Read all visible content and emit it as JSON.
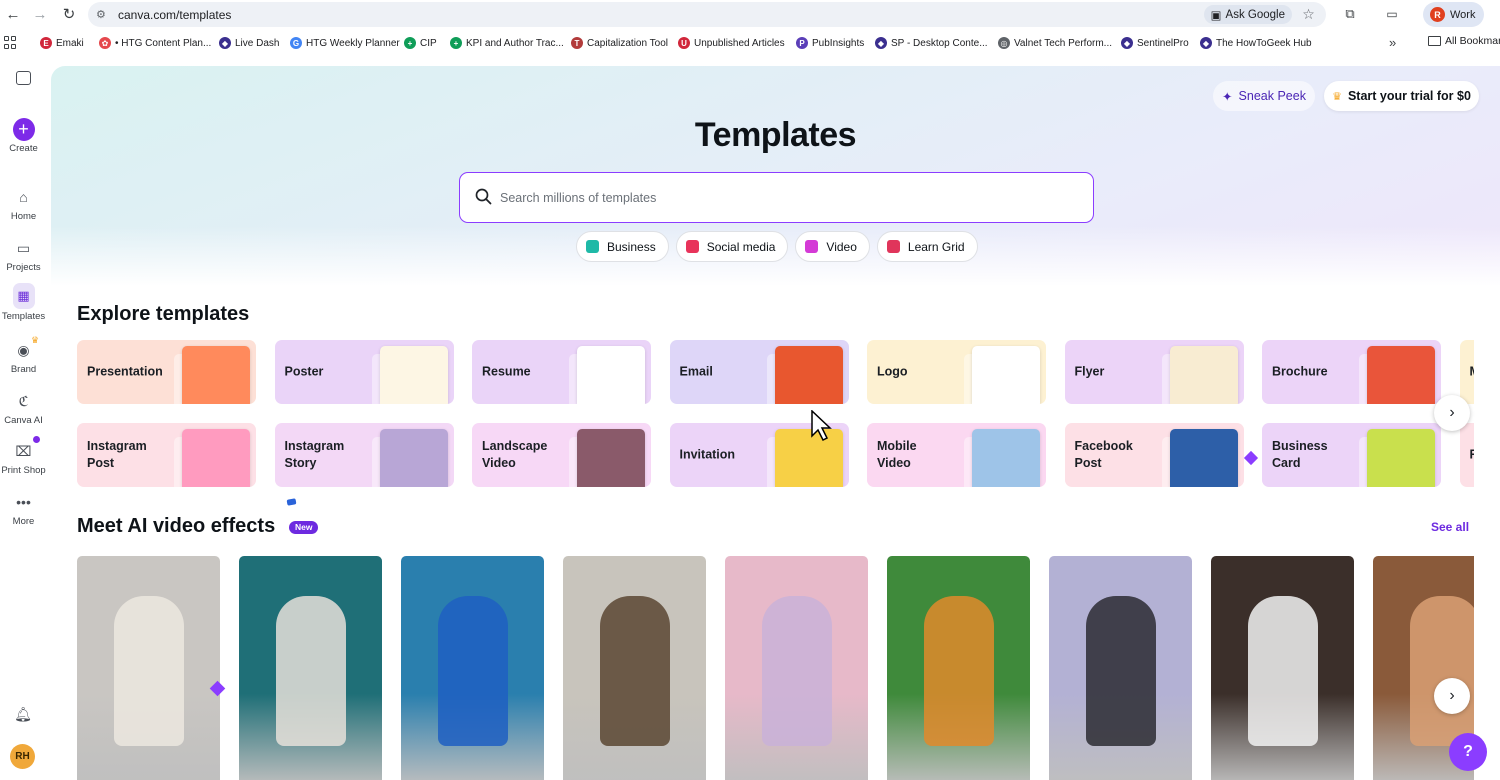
{
  "browser": {
    "url": "canva.com/templates",
    "ask_google": "Ask Google",
    "profile_initial": "R",
    "profile_label": "Work",
    "bookmarks": [
      {
        "label": "Emaki",
        "color": "#d1273b",
        "glyph": "E"
      },
      {
        "label": "• HTG Content Plan...",
        "color": "#e5484d",
        "glyph": "✿"
      },
      {
        "label": "Live Dash",
        "color": "#3b2f8f",
        "glyph": "◆"
      },
      {
        "label": "HTG Weekly Planner",
        "color": "#4285f4",
        "glyph": "G"
      },
      {
        "label": "CIP",
        "color": "#0f9d58",
        "glyph": "+"
      },
      {
        "label": "KPI and Author Trac...",
        "color": "#0f9d58",
        "glyph": "+"
      },
      {
        "label": "Capitalization Tool",
        "color": "#b23b3b",
        "glyph": "T"
      },
      {
        "label": "Unpublished Articles",
        "color": "#d1273b",
        "glyph": "U"
      },
      {
        "label": "PubInsights",
        "color": "#5b3fb8",
        "glyph": "P"
      },
      {
        "label": "SP - Desktop Conte...",
        "color": "#3b2f8f",
        "glyph": "◆"
      },
      {
        "label": "Valnet Tech Perform...",
        "color": "#5f6368",
        "glyph": "◎"
      },
      {
        "label": "SentinelPro",
        "color": "#3b2f8f",
        "glyph": "◆"
      },
      {
        "label": "The HowToGeek Hub",
        "color": "#3b2f8f",
        "glyph": "◆"
      }
    ],
    "all_bookmarks": "All Bookmarks"
  },
  "rail": {
    "create": "Create",
    "home": "Home",
    "projects": "Projects",
    "templates": "Templates",
    "brand": "Brand",
    "canva_ai": "Canva AI",
    "print_shop": "Print Shop",
    "more": "More",
    "avatar": "RH"
  },
  "header": {
    "sneak_peek": "Sneak Peek",
    "trial": "Start your trial for $0",
    "title": "Templates"
  },
  "search": {
    "placeholder": "Search millions of templates"
  },
  "chips": [
    {
      "label": "Business",
      "color": "#1fb9a7"
    },
    {
      "label": "Social media",
      "color": "#e8335a"
    },
    {
      "label": "Video",
      "color": "#d43ad6"
    },
    {
      "label": "Learn Grid",
      "color": "#e0355b"
    }
  ],
  "explore": {
    "title": "Explore templates",
    "row1": [
      {
        "label": "Presentation",
        "bg": "#fde0d6",
        "art": "#ff8a5c"
      },
      {
        "label": "Poster",
        "bg": "#ead4f8",
        "art": "#fdf6e4"
      },
      {
        "label": "Resume",
        "bg": "#ead4f8",
        "art": "#ffffff"
      },
      {
        "label": "Email",
        "bg": "#ded6f8",
        "art": "#e8572f"
      },
      {
        "label": "Logo",
        "bg": "#fdf1d2",
        "art": "#ffffff"
      },
      {
        "label": "Flyer",
        "bg": "#ecd4f8",
        "art": "#f8ecd2"
      },
      {
        "label": "Brochure",
        "bg": "#ecd4f8",
        "art": "#e9553a"
      },
      {
        "label": "M",
        "bg": "#fdf1d2",
        "art": "#fdf1d2"
      }
    ],
    "row2": [
      {
        "label": "Instagram Post",
        "bg": "#fde0e6",
        "art": "#ff9bbf"
      },
      {
        "label": "Instagram Story",
        "bg": "#f3d8f6",
        "art": "#b8a6d6"
      },
      {
        "label": "Landscape Video",
        "bg": "#f7d8f6",
        "art": "#8a5a6a"
      },
      {
        "label": "Invitation",
        "bg": "#ecd4f8",
        "art": "#f7d046"
      },
      {
        "label": "Mobile Video",
        "bg": "#fbd8f1",
        "art": "#9ec4e8"
      },
      {
        "label": "Facebook Post",
        "bg": "#fde0e6",
        "art": "#2d5fa8"
      },
      {
        "label": "Business Card",
        "bg": "#ecd4f8",
        "art": "#c9e04d"
      },
      {
        "label": "F",
        "bg": "#fde0e6",
        "art": "#fde0e6"
      }
    ]
  },
  "ai_videos": {
    "title": "Meet AI video effects",
    "badge": "New",
    "see_all": "See all",
    "thumbs": [
      {
        "name": "printer-portrait",
        "bg": "#c9c6c2",
        "fg": "#ece7df"
      },
      {
        "name": "library-skater",
        "bg": "#1f6f77",
        "fg": "#e6e1d9"
      },
      {
        "name": "underwater-bag",
        "bg": "#2a7fae",
        "fg": "#1f5fc2"
      },
      {
        "name": "knit-dolls",
        "bg": "#c8c4bc",
        "fg": "#5a4632"
      },
      {
        "name": "cloud-car",
        "bg": "#e7b9c9",
        "fg": "#c9b1d8"
      },
      {
        "name": "pixel-game",
        "bg": "#3f8a3b",
        "fg": "#e08a2c"
      },
      {
        "name": "bubble-woman",
        "bg": "#b3b1d4",
        "fg": "#2b2b33"
      },
      {
        "name": "photo-booth",
        "bg": "#3b2f2a",
        "fg": "#f2f2f2"
      },
      {
        "name": "painted-face",
        "bg": "#8a5a3a",
        "fg": "#d9a074"
      }
    ]
  }
}
